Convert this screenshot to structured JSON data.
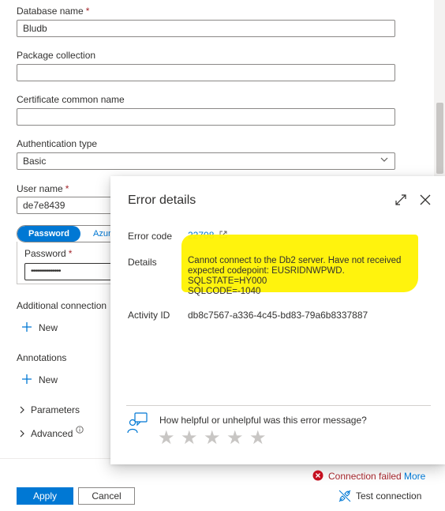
{
  "form": {
    "database_name_label": "Database name",
    "required_mark": "*",
    "database_name_value": "Bludb",
    "package_collection_label": "Package collection",
    "package_collection_value": "",
    "certificate_label": "Certificate common name",
    "certificate_value": "",
    "auth_type_label": "Authentication type",
    "auth_type_value": "Basic",
    "user_name_label": "User name",
    "user_name_value": "de7e8439",
    "toggle_password": "Password",
    "toggle_azure": "Azur",
    "password_label": "Password",
    "password_value": "•••••••••••••••",
    "additional_connection_label": "Additional connection",
    "new_label": "New",
    "annotations_label": "Annotations",
    "parameters_label": "Parameters",
    "advanced_label": "Advanced"
  },
  "modal": {
    "title": "Error details",
    "error_code_label": "Error code",
    "error_code_value": "22708",
    "details_label": "Details",
    "details_line1": "Cannot connect to the Db2 server. Have not received",
    "details_line2": "expected codepoint: EUSRIDNWPWD. SQLSTATE=HY000",
    "details_line3": "SQLCODE=-1040",
    "activity_id_label": "Activity ID",
    "activity_id_value": "db8c7567-a336-4c45-bd83-79a6b8337887",
    "feedback_question": "How helpful or unhelpful was this error message?",
    "star_rating": 0
  },
  "footer": {
    "apply_label": "Apply",
    "cancel_label": "Cancel",
    "status_text": "Connection failed",
    "more_label": "More",
    "test_connection_label": "Test connection"
  },
  "icons": {
    "expand": "expand-icon",
    "close": "close-icon",
    "external_link": "external-link-icon",
    "feedback": "feedback-icon",
    "error": "error-icon",
    "test_connection": "plug-icon",
    "info": "info-icon",
    "plus": "plus-icon",
    "chevron": "chevron-right-icon"
  },
  "colors": {
    "accent": "#0078d4",
    "error": "#a4262c",
    "highlight": "#fff200"
  }
}
